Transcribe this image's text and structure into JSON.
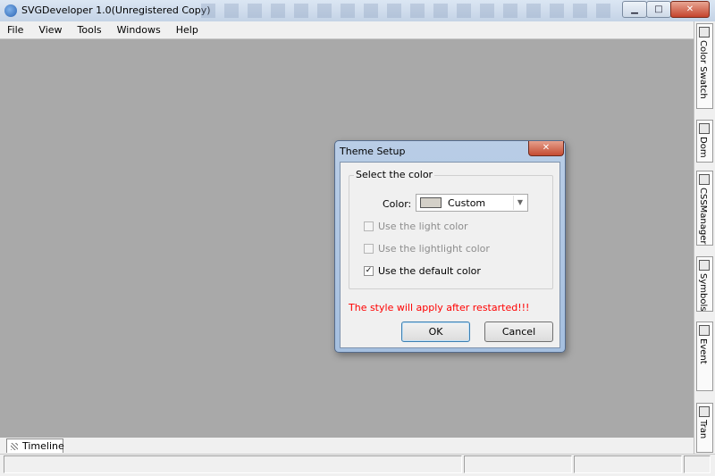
{
  "window": {
    "title": "SVGDeveloper 1.0(Unregistered Copy)",
    "controls": {
      "minimize": "▁",
      "maximize": "□",
      "close": "✕"
    }
  },
  "menu": [
    {
      "label": "File"
    },
    {
      "label": "View"
    },
    {
      "label": "Tools"
    },
    {
      "label": "Windows"
    },
    {
      "label": "Help"
    }
  ],
  "right_dock": {
    "tabs": [
      {
        "label": "Color Swatch",
        "icon": "palette-icon"
      },
      {
        "label": "Dom",
        "icon": "dom-icon"
      },
      {
        "label": "CSSManager",
        "icon": "css-icon"
      },
      {
        "label": "Symbols",
        "icon": "symbols-icon"
      },
      {
        "label": "Event",
        "icon": "event-icon"
      },
      {
        "label": "Tran",
        "icon": "transform-icon"
      }
    ]
  },
  "bottom": {
    "timeline_tab": "Timeline"
  },
  "dialog": {
    "title": "Theme Setup",
    "close_glyph": "✕",
    "group_label": "Select the color",
    "color_label": "Color:",
    "color_value": "Custom",
    "swatch_color": "#d4d0c8",
    "options": [
      {
        "label": "Use the light color",
        "checked": false,
        "enabled": false
      },
      {
        "label": "Use the lightlight color",
        "checked": false,
        "enabled": false
      },
      {
        "label": "Use the default color",
        "checked": true,
        "enabled": true
      }
    ],
    "note": "The style will apply after restarted!!!",
    "note_color": "#ff0000",
    "ok_label": "OK",
    "cancel_label": "Cancel"
  }
}
